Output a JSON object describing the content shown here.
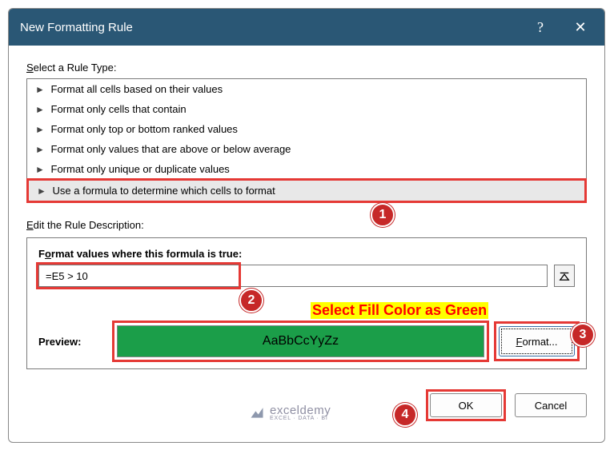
{
  "dialog": {
    "title": "New Formatting Rule",
    "help": "?",
    "close": "✕"
  },
  "sections": {
    "select_rule_label": "elect a Rule Type:",
    "select_rule_prefix": "S",
    "rules": [
      "Format all cells based on their values",
      "Format only cells that contain",
      "Format only top or bottom ranked values",
      "Format only values that are above or below average",
      "Format only unique or duplicate values",
      "Use a formula to determine which cells to format"
    ],
    "edit_label": "dit the Rule Description:",
    "edit_prefix": "E"
  },
  "formula": {
    "caption_prefix": "F",
    "caption_label_1": "ormat values where this formula is true:",
    "value": "=E5 > 10"
  },
  "preview": {
    "label": "Preview:",
    "sample": "AaBbCcYyZz",
    "fill_color": "#1b9e49",
    "format_btn": "Format..."
  },
  "buttons": {
    "ok": "OK",
    "cancel": "Cancel"
  },
  "annotations": {
    "fill_text": "Select Fill Color as Green",
    "steps": [
      "1",
      "2",
      "3",
      "4"
    ]
  },
  "watermark": {
    "text": "exceldemy",
    "sub": "EXCEL · DATA · BI"
  }
}
